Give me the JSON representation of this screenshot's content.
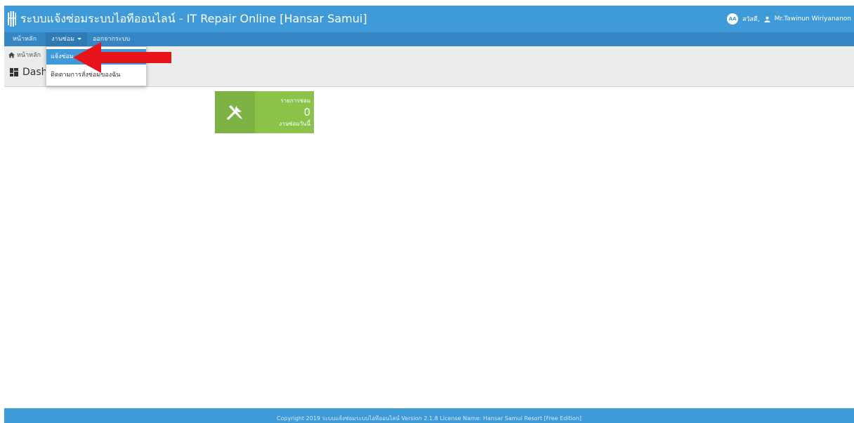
{
  "header": {
    "title": "ระบบแจ้งซ่อมระบบไอทีออนไลน์ - IT Repair Online [Hansar Samui]",
    "avatar_initials": "AA",
    "greeting": "สวัสดี,",
    "user_name": "Mr.Tawinun Wiriyananon"
  },
  "nav": {
    "items": [
      {
        "label": "หน้าหลัก"
      },
      {
        "label": "งานซ่อม"
      },
      {
        "label": "ออกจากระบบ"
      }
    ]
  },
  "dropdown": {
    "items": [
      {
        "label": "แจ้งซ่อม",
        "selected": true
      },
      {
        "label": "ติดตามการสั่งซ่อมของฉัน",
        "selected": false
      }
    ]
  },
  "breadcrumb": {
    "home_label": "หน้าหลัก"
  },
  "page": {
    "title": "Dash"
  },
  "tile": {
    "label": "รายการซ่อม",
    "value": "0",
    "sublabel": "งานซ่อมวันนี้",
    "icon": "tools-icon"
  },
  "footer": {
    "text": "Copyright 2019 ระบบแจ้งซ่อมระบบไอทีออนไลน์ Version 2.1.8 License Name: Hansar Samui Resort [Free Edition]"
  },
  "colors": {
    "header_bg": "#3e9ad8",
    "navbar_bg": "#3586c3",
    "tile_bg": "#8bc34a",
    "tile_icon_bg": "#7cb342",
    "annotation_arrow": "#e8141b"
  }
}
